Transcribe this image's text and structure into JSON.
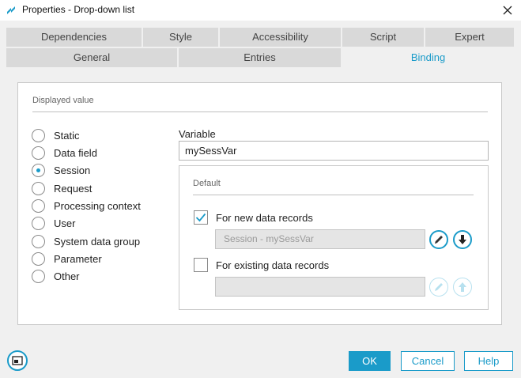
{
  "window": {
    "title": "Properties - Drop-down list"
  },
  "tabs_row1": [
    {
      "label": "Dependencies"
    },
    {
      "label": "Style"
    },
    {
      "label": "Accessibility"
    },
    {
      "label": "Script"
    },
    {
      "label": "Expert"
    }
  ],
  "tabs_row2": [
    {
      "label": "General"
    },
    {
      "label": "Entries"
    },
    {
      "label": "Binding",
      "active": true
    }
  ],
  "displayed_value": {
    "section_label": "Displayed value",
    "options": [
      {
        "label": "Static",
        "checked": false
      },
      {
        "label": "Data field",
        "checked": false
      },
      {
        "label": "Session",
        "checked": true
      },
      {
        "label": "Request",
        "checked": false
      },
      {
        "label": "Processing context",
        "checked": false
      },
      {
        "label": "User",
        "checked": false
      },
      {
        "label": "System data group",
        "checked": false
      },
      {
        "label": "Parameter",
        "checked": false
      },
      {
        "label": "Other",
        "checked": false
      }
    ]
  },
  "variable": {
    "label": "Variable",
    "value": "mySessVar"
  },
  "default": {
    "section_label": "Default",
    "new_records": {
      "label": "For new data records",
      "checked": true,
      "value": "Session - mySessVar"
    },
    "existing_records": {
      "label": "For existing data records",
      "checked": false,
      "value": ""
    }
  },
  "footer": {
    "ok_label": "OK",
    "cancel_label": "Cancel",
    "help_label": "Help"
  },
  "colors": {
    "accent": "#1a9bc9",
    "tab_inactive": "#d9d9d9",
    "dialog_bg": "#f0f0f0"
  }
}
